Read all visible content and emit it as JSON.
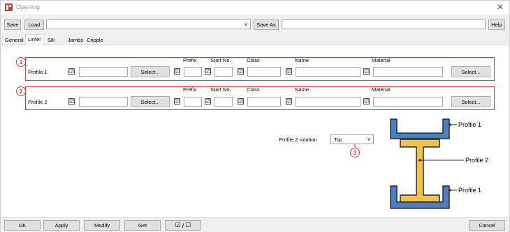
{
  "window": {
    "title": "Opening",
    "close_glyph": "✕"
  },
  "toolbar": {
    "save_label": "Save",
    "load_label": "Load",
    "load_value": "",
    "save_as_label": "Save As",
    "save_as_value": "",
    "help_label": "Help"
  },
  "tabs": [
    {
      "label": "General",
      "active": false
    },
    {
      "label": "Lintel",
      "active": true
    },
    {
      "label": "Sill",
      "active": false
    },
    {
      "label": "Jambs",
      "active": false
    },
    {
      "label": "Cripple",
      "active": false
    }
  ],
  "columns": {
    "prefix": "Prefix",
    "start_no": "Start No.",
    "class": "Class",
    "name": "Name",
    "material": "Material"
  },
  "profiles": [
    {
      "badge": "1",
      "label": "Profile 1",
      "select1": "Select...",
      "select2": "Select...",
      "checked": "☑"
    },
    {
      "badge": "2",
      "label": "Profile 2",
      "select1": "Select...",
      "select2": "Select...",
      "checked": "☑"
    }
  ],
  "rotation": {
    "label": "Profile 2 rotation",
    "value": "Top",
    "badge": "3"
  },
  "diagram": {
    "top_label": "Profile 1",
    "middle_label": "Profile 2",
    "bottom_label": "Profile 1",
    "channel_color": "#4a7fc1",
    "ibeam_color": "#f2c24f",
    "outline_color": "#2b2b2b"
  },
  "footer": {
    "ok_label": "OK",
    "apply_label": "Apply",
    "modify_label": "Modify",
    "get_label": "Get",
    "toggle_checked": "☑",
    "toggle_sep": "/",
    "toggle_unchecked": "☐",
    "cancel_label": "Cancel"
  },
  "accent": "#e03a3a"
}
